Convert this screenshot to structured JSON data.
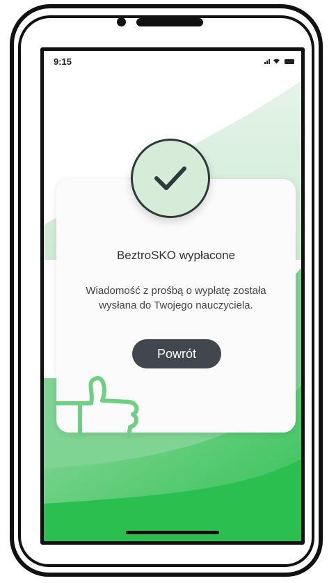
{
  "status_bar": {
    "time": "9:15"
  },
  "dialog": {
    "title": "BeztroSKO wypłacone",
    "message": "Wiadomość z prośbą o wypłatę została wysłana do Twojego nauczyciela.",
    "back_button_label": "Powrót"
  },
  "icons": {
    "success": "checkmark-icon",
    "illustration": "thumbs-up-icon"
  },
  "colors": {
    "accent_green": "#2bbf4f",
    "light_green": "#d6ecd9",
    "button_dark": "#42474f"
  }
}
